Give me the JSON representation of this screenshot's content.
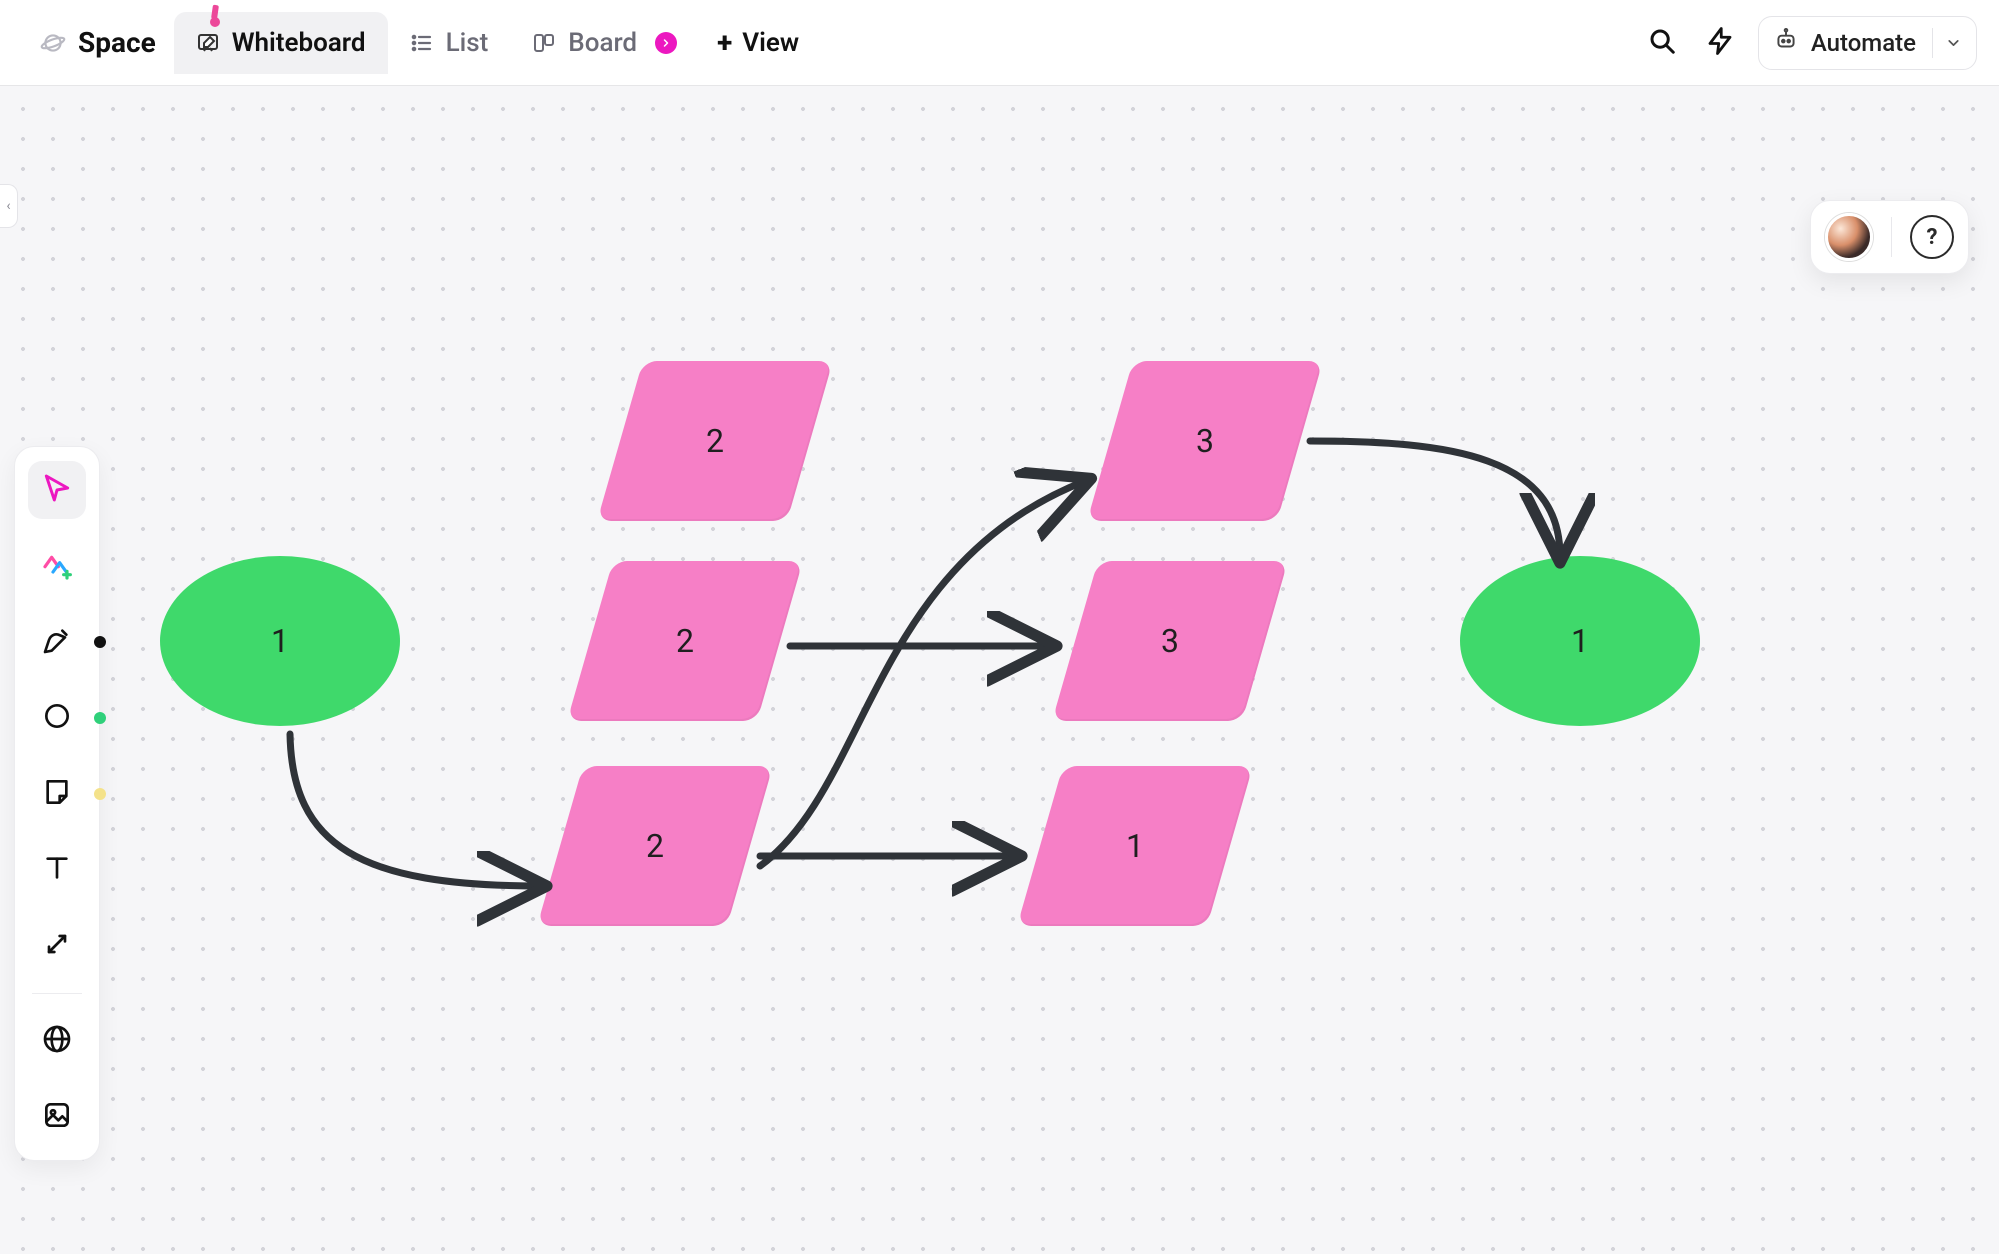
{
  "header": {
    "space_label": "Space",
    "tabs": {
      "whiteboard": "Whiteboard",
      "list": "List",
      "board": "Board"
    },
    "add_view_label": "View",
    "automate_label": "Automate"
  },
  "canvas": {
    "shapes": {
      "oval_left": "1",
      "oval_right": "1",
      "col2_top": "2",
      "col2_mid": "2",
      "col2_bot": "2",
      "col3_top": "3",
      "col3_mid": "3",
      "col3_bot": "1"
    }
  },
  "colors": {
    "green": "#3fd96b",
    "pink": "#f67fc6",
    "magenta": "#ec18c0",
    "stroke": "#2f3338"
  }
}
